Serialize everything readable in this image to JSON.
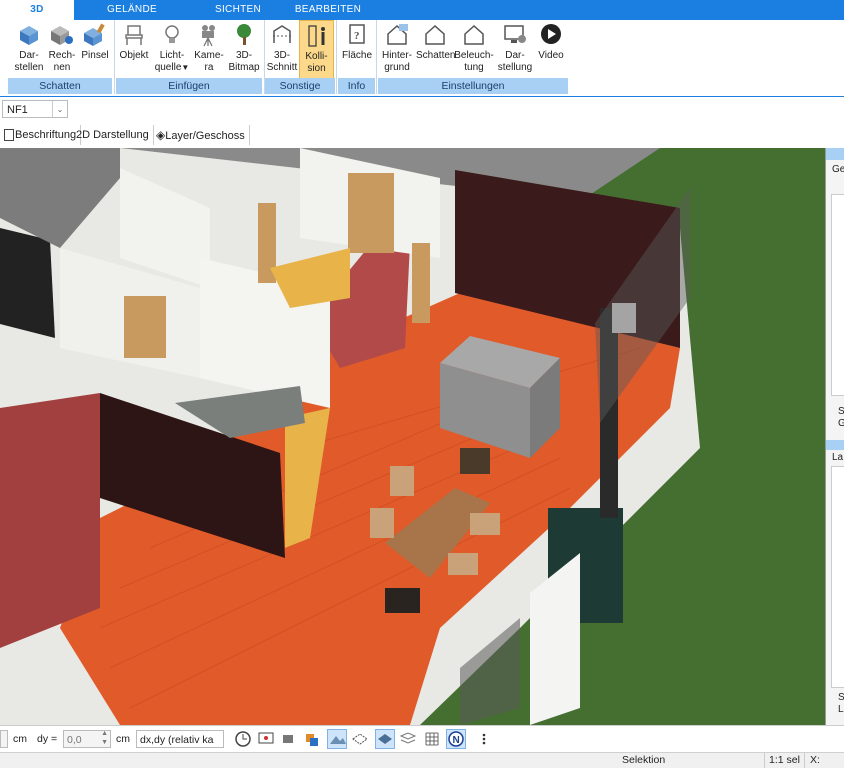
{
  "tabs": [
    "3D",
    "GELÄNDE",
    "SICHTEN",
    "BEARBEITEN"
  ],
  "ribbon": {
    "buttons": [
      {
        "l1": "Dar-",
        "l2": "stellen",
        "icon": "cube-display-icon"
      },
      {
        "l1": "Rech-",
        "l2": "nen",
        "icon": "cube-render-icon"
      },
      {
        "l1": "Pinsel",
        "l2": "",
        "icon": "cube-brush-icon"
      },
      {
        "l1": "Objekt",
        "l2": "",
        "icon": "chair-icon"
      },
      {
        "l1": "Licht-",
        "l2": "quelle",
        "icon": "lightbulb-icon"
      },
      {
        "l1": "Kame-",
        "l2": "ra",
        "icon": "camera-icon"
      },
      {
        "l1": "3D-",
        "l2": "Bitmap",
        "icon": "tree-icon"
      },
      {
        "l1": "3D-",
        "l2": "Schnitt",
        "icon": "section-cut-icon"
      },
      {
        "l1": "Kolli-",
        "l2": "sion",
        "icon": "person-collision-icon"
      },
      {
        "l1": "Fläche",
        "l2": "",
        "icon": "area-info-icon"
      },
      {
        "l1": "Hinter-",
        "l2": "grund",
        "icon": "house-background-icon"
      },
      {
        "l1": "Schatten",
        "l2": "",
        "icon": "house-shadow-icon"
      },
      {
        "l1": "Beleuch-",
        "l2": "tung",
        "icon": "house-light-icon"
      },
      {
        "l1": "Dar-",
        "l2": "stellung",
        "icon": "monitor-settings-icon"
      },
      {
        "l1": "Video",
        "l2": "",
        "icon": "play-icon"
      }
    ],
    "groups": [
      "Schatten",
      "Einfügen",
      "Sonstige",
      "Info",
      "Einstellungen"
    ]
  },
  "floor_select": "NF1",
  "view_buttons": [
    "Beschriftung",
    "2D Darstellung",
    "Layer/Geschoss"
  ],
  "right_panel": {
    "top_label": "Ge",
    "mid_label": "La",
    "s1": "S",
    "s2": "G",
    "s3": "S",
    "s4": "L"
  },
  "input_bar": {
    "unit1": "cm",
    "dy_label": "dy =",
    "dy_value": "0,0",
    "unit2": "cm",
    "mode": "dx,dy (relativ ka"
  },
  "status": {
    "mode": "Selektion",
    "sel": "1:1 sel",
    "x": "X:"
  },
  "colors": {
    "accent": "#1a7fe0",
    "ribbon_group": "#a8d0f5",
    "selected": "#fcd98a",
    "floor_wood": "#e05a2a",
    "grass": "#3e6d2e"
  }
}
